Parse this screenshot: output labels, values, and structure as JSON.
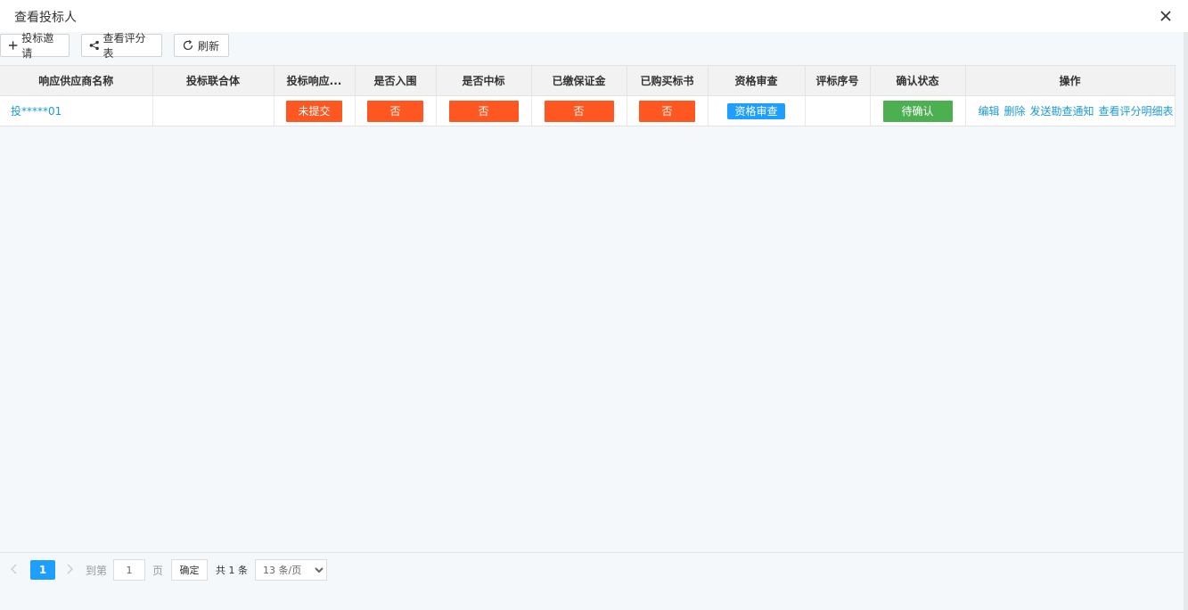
{
  "dialog": {
    "title": "查看投标人"
  },
  "toolbar": {
    "invite_label": "投标邀请",
    "view_score_label": "查看评分表",
    "refresh_label": "刷新"
  },
  "table": {
    "headers": [
      "响应供应商名称",
      "投标联合体",
      "投标响应...",
      "是否入围",
      "是否中标",
      "已缴保证金",
      "已购买标书",
      "资格审查",
      "评标序号",
      "确认状态",
      "操作"
    ],
    "rows": [
      {
        "supplier": "投*****01",
        "consortium": "",
        "response": "未提交",
        "shortlisted": "否",
        "winning": "否",
        "deposit_paid": "否",
        "doc_purchased": "否",
        "qualification": "资格审查",
        "eval_order": "",
        "confirm_status": "待确认",
        "ops": [
          "编辑",
          "删除",
          "发送勘查通知",
          "查看评分明细表"
        ]
      }
    ]
  },
  "pager": {
    "current": "1",
    "goto_label": "到第",
    "goto_value": "1",
    "page_label": "页",
    "confirm_label": "确定",
    "total_label": "共 1 条",
    "page_size_label": "13 条/页"
  },
  "colors": {
    "orange": "#ff5722",
    "blue": "#1e9fff",
    "green": "#4cb050",
    "link": "#1c9ad6"
  }
}
